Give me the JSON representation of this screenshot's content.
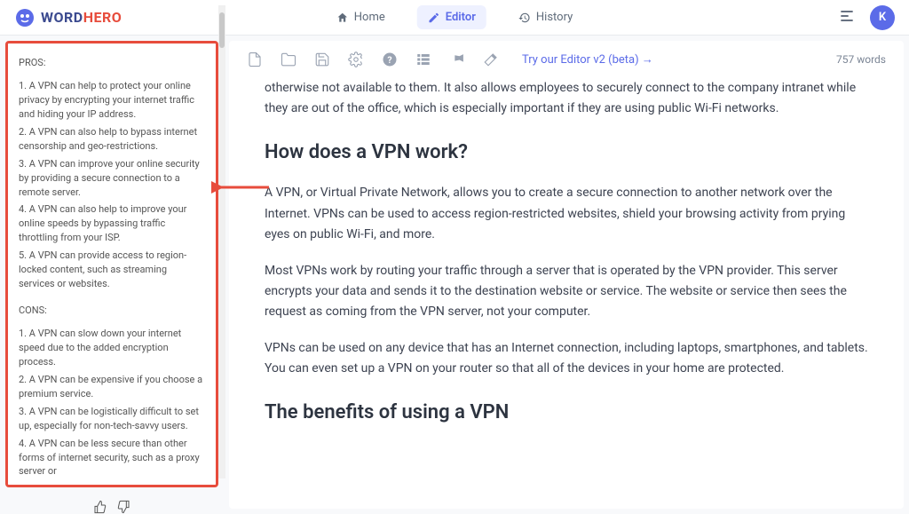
{
  "logo": {
    "word": "WORD",
    "hero": "HERO"
  },
  "nav": {
    "home": "Home",
    "editor": "Editor",
    "history": "History"
  },
  "avatar_initial": "K",
  "sidebar": {
    "pros_title": "PROS:",
    "pros": [
      "1. A VPN can help to protect your online privacy by encrypting your internet traffic and hiding your IP address.",
      "2. A VPN can also help to bypass internet censorship and geo-restrictions.",
      "3. A VPN can improve your online security by providing a secure connection to a remote server.",
      "4. A VPN can also help to improve your online speeds by bypassing traffic throttling from your ISP.",
      "5. A VPN can provide access to region-locked content, such as streaming services or websites."
    ],
    "cons_title": "CONS:",
    "cons": [
      "1. A VPN can slow down your internet speed due to the added encryption process.",
      "2. A VPN can be expensive if you choose a premium service.",
      "3. A VPN can be logistically difficult to set up, especially for non-tech-savvy users.",
      "4. A VPN can be less secure than other forms of internet security, such as a proxy server or"
    ]
  },
  "toolbar": {
    "try_v2": "Try our Editor v2 (beta) →",
    "word_count": "757 words"
  },
  "article": {
    "p1": "otherwise not available to them. It also allows employees to securely connect to the company intranet while they are out of the office, which is especially important if they are using public Wi-Fi networks.",
    "h1": "How does a VPN work?",
    "p2": "A VPN, or Virtual Private Network, allows you to create a secure connection to another network over the Internet. VPNs can be used to access region-restricted websites, shield your browsing activity from prying eyes on public Wi-Fi, and more.",
    "p3": "Most VPNs work by routing your traffic through a server that is operated by the VPN provider. This server encrypts your data and sends it to the destination website or service. The website or service then sees the request as coming from the VPN server, not your computer.",
    "p4": "VPNs can be used on any device that has an Internet connection, including laptops, smartphones, and tablets. You can even set up a VPN on your router so that all of the devices in your home are protected.",
    "h2": "The benefits of using a VPN"
  }
}
